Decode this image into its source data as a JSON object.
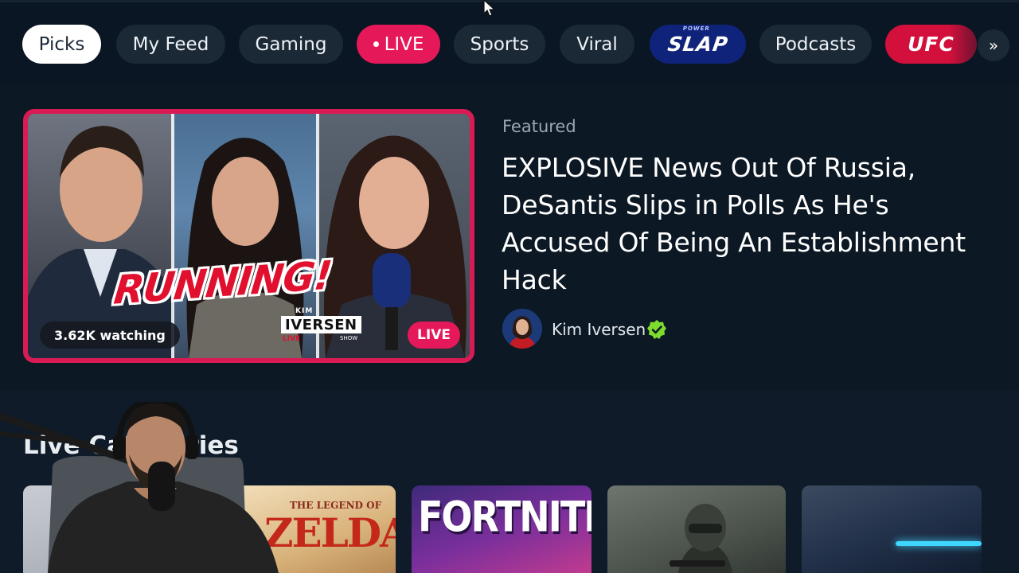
{
  "nav": {
    "tabs": [
      {
        "label": "Picks",
        "active": true
      },
      {
        "label": "My Feed"
      },
      {
        "label": "Gaming"
      },
      {
        "label": "LIVE"
      },
      {
        "label": "Sports"
      },
      {
        "label": "Viral"
      },
      {
        "label": "SLAP",
        "brand": true,
        "brand_sub": "POWER"
      },
      {
        "label": "Podcasts"
      },
      {
        "label": "UFC",
        "brand": true
      }
    ],
    "more_label": "»"
  },
  "featured": {
    "section_label": "Featured",
    "title": "EXPLOSIVE News Out Of Russia, DeSantis Slips in Polls As He's Accused Of Being An Establishment Hack",
    "watching": "3.62K watching",
    "live_badge": "LIVE",
    "overlay_text": "RUNNING!",
    "show_logo": {
      "top": "KIM",
      "name": "IVERSEN",
      "sub": "LIVE",
      "tag": "SHOW"
    },
    "author": {
      "name": "Kim Iversen",
      "verified": true
    }
  },
  "categories": {
    "heading": "Live Categories",
    "tiles": [
      {
        "name": "",
        "title": ""
      },
      {
        "name": "zelda",
        "subtitle": "THE LEGEND OF",
        "title": "ZELDA"
      },
      {
        "name": "fortnite",
        "title": "FORTNITE"
      },
      {
        "name": "call-of-duty",
        "title": ""
      },
      {
        "name": "pc-hardware",
        "title": ""
      }
    ]
  },
  "colors": {
    "background": "#0f1b28",
    "nav_background": "#0a1623",
    "pill": "#1b2937",
    "live_accent": "#e5185a",
    "slap_brand": "#10237a",
    "ufc_brand": "#d3103c",
    "verified": "#7ddc2f"
  }
}
